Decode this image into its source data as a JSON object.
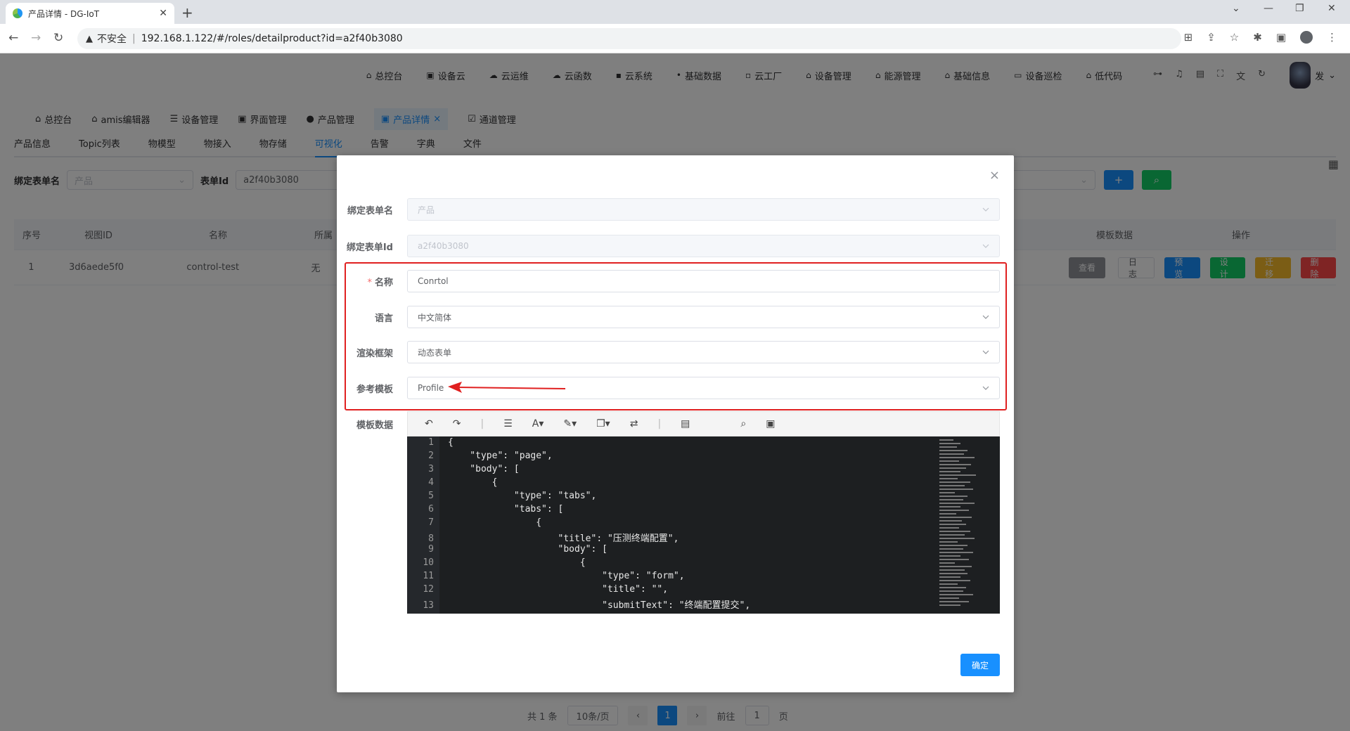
{
  "browser": {
    "tab_title": "产品详情 - DG-IoT",
    "security_label": "不安全",
    "url": "192.168.1.122/#/roles/detailproduct?id=a2f40b3080"
  },
  "topnav": {
    "items": [
      "总控台",
      "设备云",
      "云运维",
      "云函数",
      "云系统",
      "基础数据",
      "云工厂",
      "设备管理",
      "能源管理",
      "基础信息",
      "设备巡检",
      "低代码"
    ],
    "user_label": "发"
  },
  "tagsview": {
    "tags": [
      "总控台",
      "amis编辑器",
      "设备管理",
      "界面管理",
      "产品管理",
      "产品详情",
      "通道管理"
    ],
    "active_index": 5
  },
  "subtabs": {
    "items": [
      "产品信息",
      "Topic列表",
      "物模型",
      "物接入",
      "物存储",
      "可视化",
      "告警",
      "字典",
      "文件"
    ],
    "active_index": 5
  },
  "filter": {
    "label_form_name": "绑定表单名",
    "placeholder_form_name": "产品",
    "label_form_id": "表单Id",
    "value_form_id": "a2f40b3080",
    "add_button": "+",
    "search_button": "⌕"
  },
  "table": {
    "headers": [
      "序号",
      "视图ID",
      "名称",
      "所属",
      "模板数据",
      "操作"
    ],
    "rows": [
      {
        "index": "1",
        "view_id": "3d6aede5f0",
        "name": "control-test",
        "belong": "无"
      }
    ],
    "view_button": "查看",
    "ops": [
      "日志",
      "预览",
      "设计",
      "迁移",
      "删除"
    ]
  },
  "pagination": {
    "total": "共 1 条",
    "page_size": "10条/页",
    "current_page": "1",
    "goto_label": "前往",
    "goto_value": "1",
    "page_unit": "页"
  },
  "dialog": {
    "close_symbol": "×",
    "fields": {
      "form_name": {
        "label": "绑定表单名",
        "value": "产品"
      },
      "form_id": {
        "label": "绑定表单Id",
        "value": "a2f40b3080"
      },
      "name": {
        "required_mark": "*",
        "label": "名称",
        "value": "Conrtol"
      },
      "language": {
        "label": "语言",
        "value": "中文简体"
      },
      "framework": {
        "label": "渲染框架",
        "value": "动态表单"
      },
      "template": {
        "label": "参考模板",
        "value": "Profile"
      },
      "template_data": {
        "label": "模板数据"
      }
    },
    "confirm_button": "确定",
    "code_lines": [
      {
        "n": "1",
        "text": "{"
      },
      {
        "n": "2",
        "text": "    \"type\": \"page\","
      },
      {
        "n": "3",
        "text": "    \"body\": ["
      },
      {
        "n": "4",
        "text": "        {"
      },
      {
        "n": "5",
        "text": "            \"type\": \"tabs\","
      },
      {
        "n": "6",
        "text": "            \"tabs\": ["
      },
      {
        "n": "7",
        "text": "                {"
      },
      {
        "n": "8",
        "text": "                    \"title\": \"压测终端配置\","
      },
      {
        "n": "9",
        "text": "                    \"body\": ["
      },
      {
        "n": "10",
        "text": "                        {"
      },
      {
        "n": "11",
        "text": "                            \"type\": \"form\","
      },
      {
        "n": "12",
        "text": "                            \"title\": \"\","
      },
      {
        "n": "13",
        "text": "                            \"submitText\": \"终端配置提交\","
      }
    ]
  },
  "colors": {
    "primary": "#1890ff",
    "success": "#13ce66",
    "warning": "#f7ba2a",
    "danger": "#ff4949",
    "highlight_box": "#e02020"
  }
}
